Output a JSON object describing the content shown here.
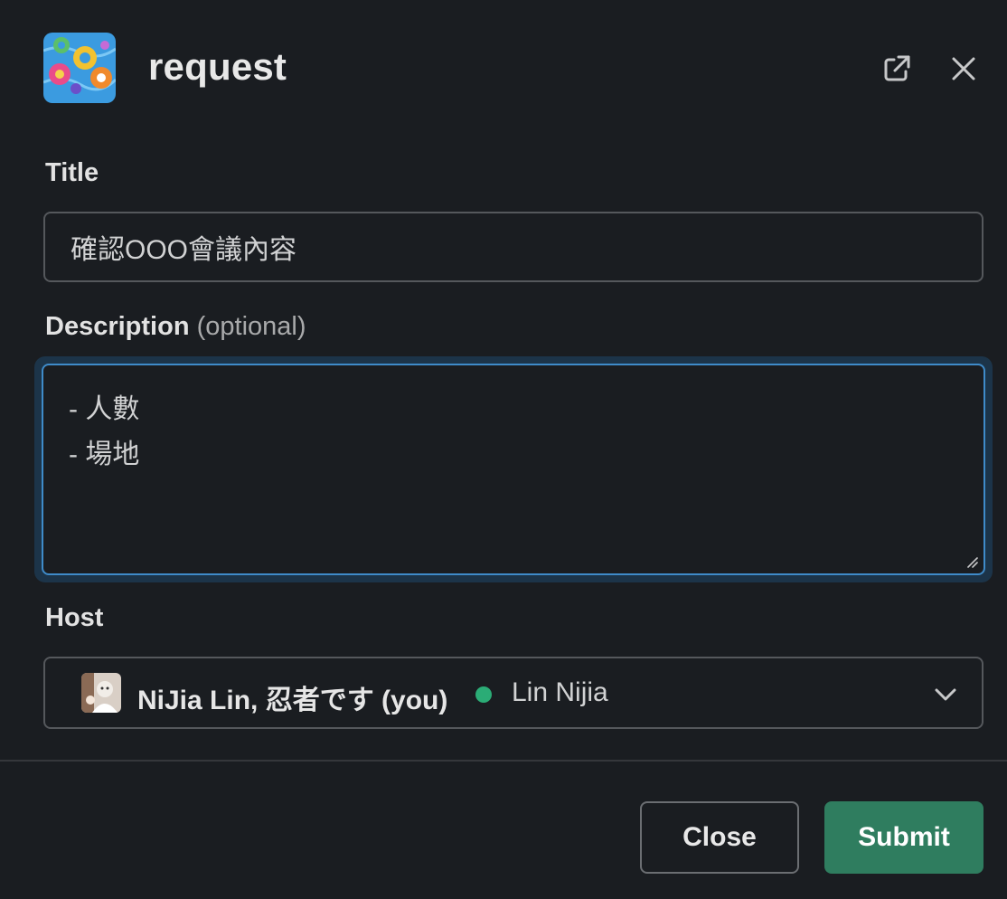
{
  "header": {
    "title": "request",
    "app_icon": "pool-floats-app-icon",
    "open_icon": "external-link-icon",
    "close_icon": "close-icon"
  },
  "fields": {
    "title": {
      "label": "Title",
      "value": "確認OOO會議內容"
    },
    "description": {
      "label": "Description",
      "optional_label": "(optional)",
      "value": "- 人數\n- 場地"
    },
    "host": {
      "label": "Host",
      "selected_name": "NiJia Lin, 忍者です (you)",
      "selected_display_name": "Lin Nijia",
      "status": "active",
      "status_color": "#2bac76",
      "dropdown_icon": "chevron-down-icon"
    }
  },
  "footer": {
    "close_label": "Close",
    "submit_label": "Submit",
    "submit_color": "#2f7d5f"
  }
}
